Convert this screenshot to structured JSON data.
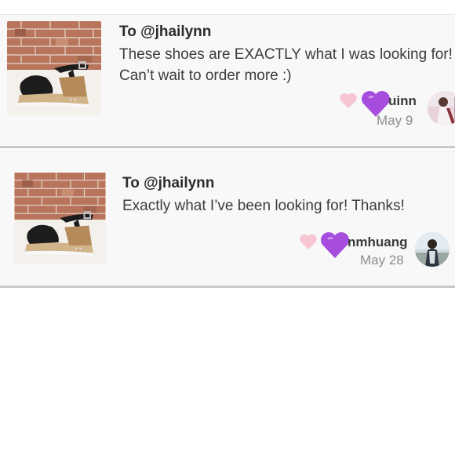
{
  "comments": [
    {
      "recipient": "To @jhailynn",
      "message": "These shoes are EXACTLY what I was looking for! Can’t wait to order more :)",
      "username": "uinn",
      "date": "May 9",
      "thumbnail_icon": "black-espadrille-sandal-photo",
      "avatar_icon": "user-avatar"
    },
    {
      "recipient": "To @jhailynn",
      "message": "Exactly what I’ve been looking for! Thanks!",
      "username": "nmhuang",
      "date": "May 28",
      "thumbnail_icon": "black-espadrille-sandal-photo",
      "avatar_icon": "user-avatar"
    }
  ],
  "colors": {
    "like_heart": "#f7c6d2",
    "purple_heart": "#a64ddd",
    "card_background": "#f8f8f8",
    "card_divider": "#c9c9c9"
  }
}
